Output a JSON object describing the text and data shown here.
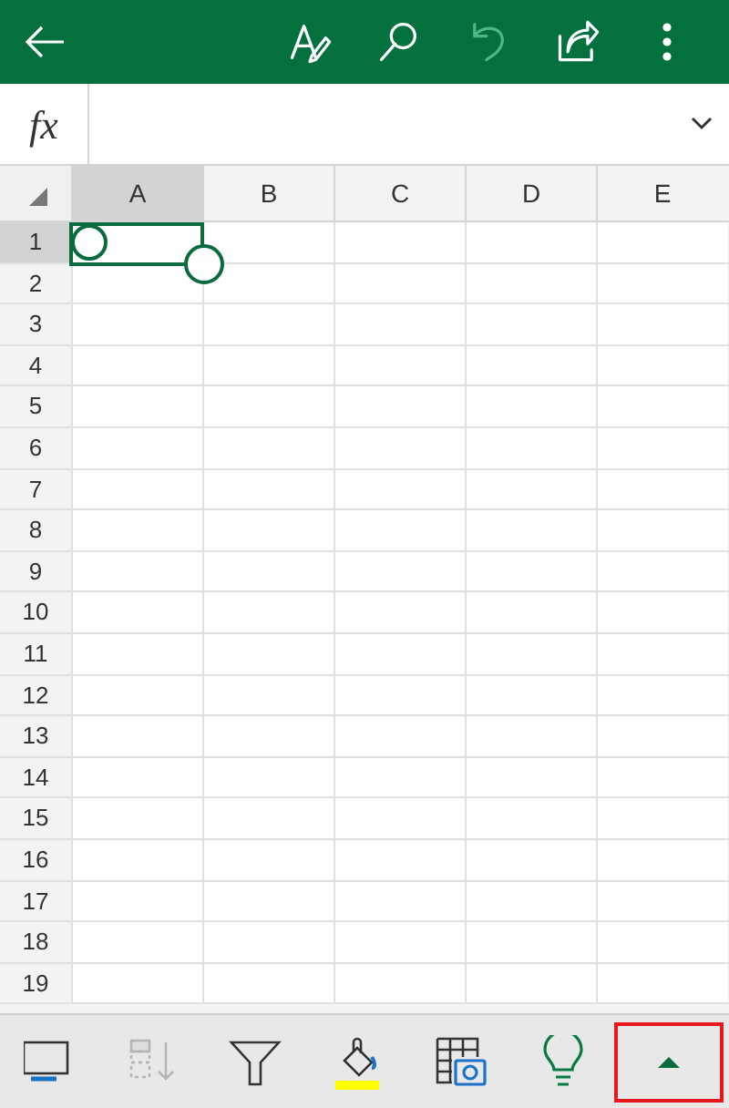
{
  "toolbar": {
    "actions": [
      {
        "kind": "draw"
      },
      {
        "kind": "search"
      },
      {
        "kind": "undo",
        "disabled": true
      },
      {
        "kind": "share"
      },
      {
        "kind": "more"
      }
    ]
  },
  "formula_bar": {
    "label": "fx"
  },
  "sheet": {
    "columns": [
      {
        "label": "A",
        "selected": true
      },
      {
        "label": "B",
        "selected": false
      },
      {
        "label": "C",
        "selected": false
      },
      {
        "label": "D",
        "selected": false
      },
      {
        "label": "E",
        "selected": false
      }
    ],
    "rows": [
      {
        "label": "1",
        "selected": true
      },
      {
        "label": "2",
        "selected": false
      },
      {
        "label": "3",
        "selected": false
      },
      {
        "label": "4",
        "selected": false
      },
      {
        "label": "5",
        "selected": false
      },
      {
        "label": "6",
        "selected": false
      },
      {
        "label": "7",
        "selected": false
      },
      {
        "label": "8",
        "selected": false
      },
      {
        "label": "9",
        "selected": false
      },
      {
        "label": "10",
        "selected": false
      },
      {
        "label": "11",
        "selected": false
      },
      {
        "label": "12",
        "selected": false
      },
      {
        "label": "13",
        "selected": false
      },
      {
        "label": "14",
        "selected": false
      },
      {
        "label": "15",
        "selected": false
      },
      {
        "label": "16",
        "selected": false
      },
      {
        "label": "17",
        "selected": false
      },
      {
        "label": "18",
        "selected": false
      },
      {
        "label": "19",
        "selected": false
      }
    ]
  },
  "bottom_bar": {
    "items": [
      {
        "kind": "display",
        "disabled": false,
        "highlighted": false
      },
      {
        "kind": "sort",
        "disabled": true,
        "highlighted": false
      },
      {
        "kind": "filter",
        "disabled": false,
        "highlighted": false
      },
      {
        "kind": "fill",
        "disabled": false,
        "highlighted": false
      },
      {
        "kind": "table-photo",
        "disabled": false,
        "highlighted": false
      },
      {
        "kind": "idea",
        "disabled": false,
        "highlighted": false
      },
      {
        "kind": "expand",
        "disabled": false,
        "highlighted": true
      }
    ]
  }
}
